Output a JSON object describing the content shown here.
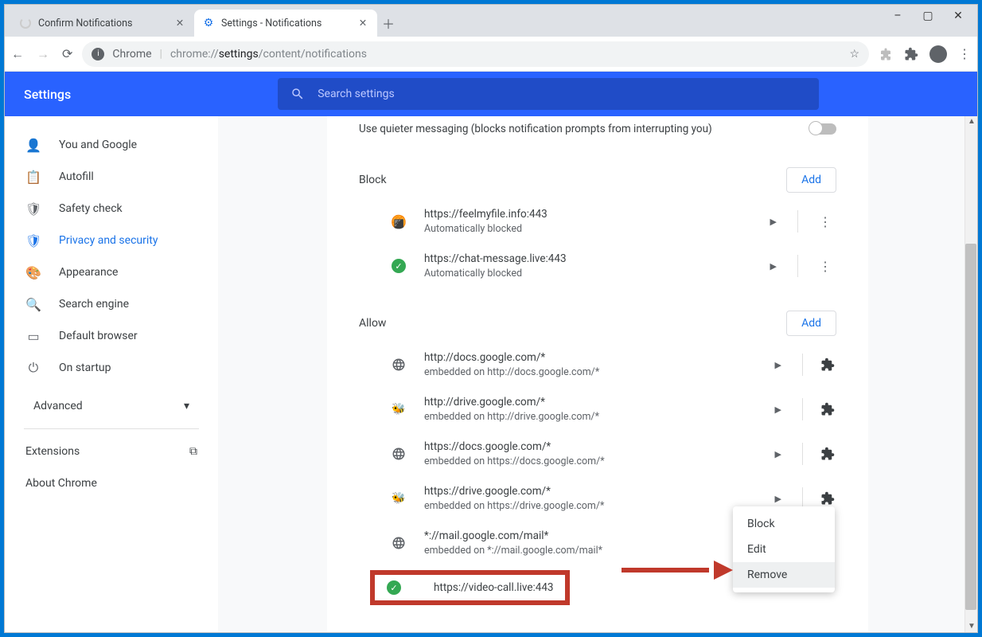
{
  "window": {
    "minimize": "–",
    "maximize": "▢",
    "close": "✕"
  },
  "tabs": {
    "inactive": {
      "title": "Confirm Notifications"
    },
    "active": {
      "title": "Settings - Notifications"
    }
  },
  "omnibox": {
    "app": "Chrome",
    "url_gray1": "chrome://",
    "url_dark": "settings",
    "url_gray2": "/content/notifications"
  },
  "bluebar": {
    "title": "Settings",
    "search_placeholder": "Search settings"
  },
  "sidebar": {
    "items": [
      {
        "icon": "person",
        "label": "You and Google"
      },
      {
        "icon": "clipboard",
        "label": "Autofill"
      },
      {
        "icon": "shield-check",
        "label": "Safety check"
      },
      {
        "icon": "shield",
        "label": "Privacy and security"
      },
      {
        "icon": "palette",
        "label": "Appearance"
      },
      {
        "icon": "search",
        "label": "Search engine"
      },
      {
        "icon": "browser",
        "label": "Default browser"
      },
      {
        "icon": "power",
        "label": "On startup"
      }
    ],
    "advanced": "Advanced",
    "extensions": "Extensions",
    "about": "About Chrome"
  },
  "settings": {
    "quiet_text": "Use quieter messaging (blocks notification prompts from interrupting you)",
    "block_label": "Block",
    "allow_label": "Allow",
    "add_label": "Add",
    "block_list": [
      {
        "icon": "cookie",
        "url": "https://feelmyfile.info:443",
        "sub": "Automatically blocked"
      },
      {
        "icon": "check",
        "url": "https://chat-message.live:443",
        "sub": "Automatically blocked"
      }
    ],
    "allow_list": [
      {
        "icon": "globe",
        "url": "http://docs.google.com/*",
        "sub": "embedded on http://docs.google.com/*"
      },
      {
        "icon": "bee",
        "url": "http://drive.google.com/*",
        "sub": "embedded on http://drive.google.com/*"
      },
      {
        "icon": "globe",
        "url": "https://docs.google.com/*",
        "sub": "embedded on https://docs.google.com/*"
      },
      {
        "icon": "bee",
        "url": "https://drive.google.com/*",
        "sub": "embedded on https://drive.google.com/*"
      },
      {
        "icon": "globe",
        "url": "*://mail.google.com/mail*",
        "sub": "embedded on *://mail.google.com/mail*"
      }
    ],
    "highlighted": {
      "url": "https://video-call.live:443"
    }
  },
  "ctx": {
    "block": "Block",
    "edit": "Edit",
    "remove": "Remove"
  }
}
